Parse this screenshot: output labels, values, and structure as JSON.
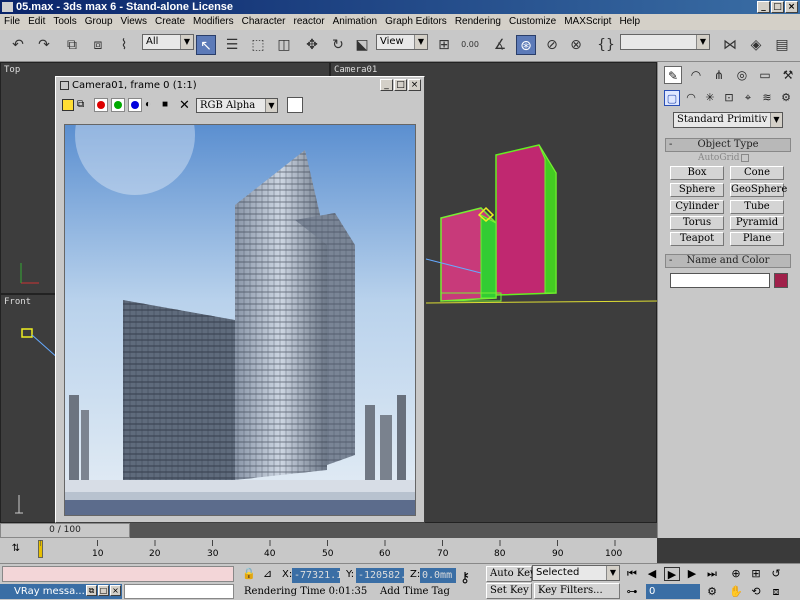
{
  "app": {
    "title": "05.max - 3ds max 6 - Stand-alone License",
    "window_controls": [
      "_",
      "□",
      "×"
    ]
  },
  "menu": [
    "File",
    "Edit",
    "Tools",
    "Group",
    "Views",
    "Create",
    "Modifiers",
    "Character",
    "reactor",
    "Animation",
    "Graph Editors",
    "Rendering",
    "Customize",
    "MAXScript",
    "Help"
  ],
  "toolbar": {
    "selection_filter": "All",
    "ref_coord": "View",
    "spinner_label": "0.00",
    "named_selection": ""
  },
  "viewports": {
    "top": "Top",
    "front": "Front",
    "camera": "Camera01"
  },
  "render_window": {
    "title": "Camera01, frame 0 (1:1)",
    "channel_dropdown": "RGB Alpha",
    "controls": [
      "_",
      "□",
      "×"
    ]
  },
  "command_panel": {
    "category_dropdown": "Standard Primitiv",
    "object_type_label": "Object Type",
    "autogrid_label": "AutoGrid",
    "primitives": [
      "Box",
      "Cone",
      "Sphere",
      "GeoSphere",
      "Cylinder",
      "Tube",
      "Torus",
      "Pyramid",
      "Teapot",
      "Plane"
    ],
    "name_color_label": "Name and Color",
    "object_color": "#a0204a"
  },
  "timeline": {
    "frame_display": "0 / 100",
    "ticks": [
      "10",
      "20",
      "30",
      "40",
      "50",
      "60",
      "70",
      "80",
      "90",
      "100"
    ]
  },
  "status": {
    "vray_window": "VRay messa...",
    "x_label": "X:",
    "x_value": "-77321.1",
    "y_label": "Y:",
    "y_value": "-120582.",
    "z_label": "Z:",
    "z_value": "0.0mm",
    "rendering_time": "Rendering Time  0:01:35",
    "add_time_tag": "Add Time Tag",
    "auto_key": "Auto Key",
    "key_mode": "Selected",
    "set_key": "Set Key",
    "key_filters": "Key Filters...",
    "current_frame": "0"
  }
}
